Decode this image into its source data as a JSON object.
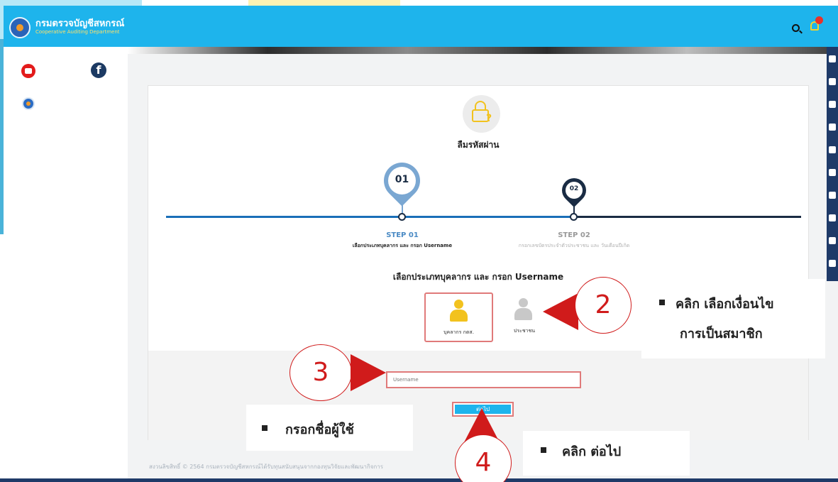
{
  "header": {
    "dept_name_th": "กรมตรวจบัญชีสหกรณ์",
    "dept_name_en": "Cooperative Auditing Department",
    "search_icon": "search-icon",
    "bell_icon": "bell-icon"
  },
  "left_sidebar": {
    "icons": [
      "youtube-icon",
      "facebook-icon",
      "dept-logo-icon"
    ]
  },
  "right_sidebar": {
    "icons": [
      "home-icon",
      "video-icon",
      "users-icon",
      "database-icon",
      "scale-icon",
      "chat-icon",
      "question-icon",
      "comment-icon",
      "calendar-icon",
      "sitemap-icon",
      "chart-icon"
    ]
  },
  "form": {
    "title": "ลืมรหัสผ่าน",
    "step1": {
      "number": "01",
      "title": "STEP 01",
      "subtitle": "เลือกประเภทบุคลากร และ กรอก Username"
    },
    "step2": {
      "number": "02",
      "title": "STEP 02",
      "subtitle": "กรอกเลขบัตรประจำตัวประชาชน และ วันเดือนปีเกิด"
    },
    "section_heading": "เลือกประเภทบุคลากร และ กรอก Username",
    "option_staff_label": "บุคลากร กตส.",
    "option_public_label": "ประชาชน",
    "username_placeholder": "Username",
    "next_button_label": "ต่อไป"
  },
  "footer": {
    "copyright": "สงวนลิขสิทธิ์ © 2564 กรมตรวจบัญชีสหกรณ์ได้รับทุนสนับสนุนจากกองทุนวิจัยและพัฒนากิจการ"
  },
  "annotations": {
    "step2_num": "2",
    "step2_text_line1": "คลิก เลือกเงื่อนไข",
    "step2_text_line2": "การเป็นสมาชิก",
    "step3_num": "3",
    "step3_text": "กรอกชื่อผู้ใช้",
    "step4_num": "4",
    "step4_text": "คลิก ต่อไป"
  },
  "colors": {
    "header_bg": "#1eb4ec",
    "accent_navy": "#1a2c44",
    "step1_blue": "#7aa7d2",
    "highlight_red": "#e07a7a",
    "annotation_red": "#d01b1b",
    "staff_yellow": "#f2c21e"
  }
}
